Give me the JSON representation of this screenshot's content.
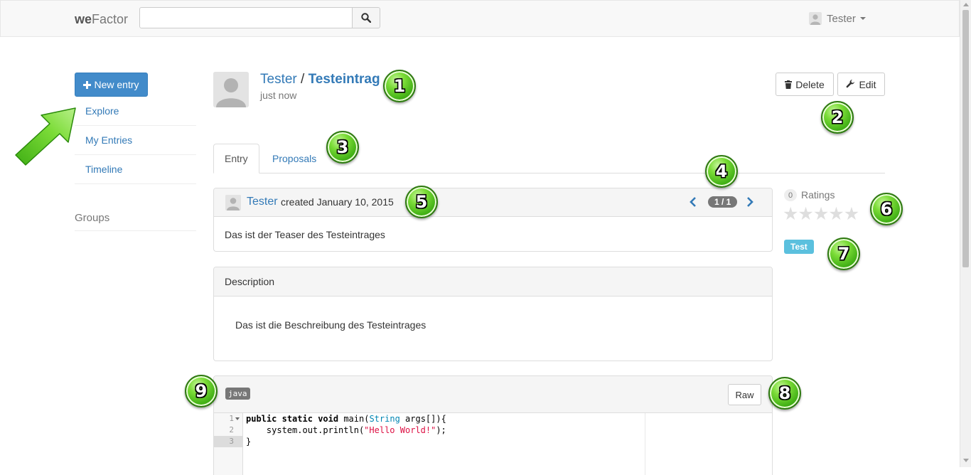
{
  "navbar": {
    "brand_prefix": "we",
    "brand_suffix": "Factor",
    "search": {
      "value": "",
      "placeholder": ""
    },
    "user_name": "Tester"
  },
  "sidebar": {
    "new_entry_label": "New entry",
    "items": [
      {
        "label": "Explore"
      },
      {
        "label": "My Entries"
      },
      {
        "label": "Timeline"
      }
    ],
    "groups_label": "Groups"
  },
  "entry": {
    "author": "Tester",
    "separator": "/",
    "title": "Testeintrag",
    "time": "just now",
    "delete_label": "Delete",
    "edit_label": "Edit"
  },
  "tabs": [
    {
      "label": "Entry",
      "active": true
    },
    {
      "label": "Proposals",
      "active": false
    }
  ],
  "version_panel": {
    "author": "Tester",
    "created_text": "created January 10, 2015",
    "page_indicator": "1 / 1",
    "teaser": "Das ist der Teaser des Testeintrages"
  },
  "description_panel": {
    "heading": "Description",
    "body": "Das ist die Beschreibung des Testeintrages"
  },
  "ratings": {
    "count": "0",
    "label": "Ratings",
    "stars_filled": 0,
    "stars_total": 5
  },
  "tag": {
    "label": "Test"
  },
  "code_panel": {
    "language": "java",
    "raw_label": "Raw",
    "lines": [
      {
        "number": "1"
      },
      {
        "number": "2"
      },
      {
        "number": "3"
      }
    ]
  },
  "callouts": [
    "1",
    "2",
    "3",
    "4",
    "5",
    "6",
    "7",
    "8",
    "9"
  ],
  "colors": {
    "primary": "#428bca",
    "link": "#337ab7",
    "tag": "#5bc0de",
    "badge": "#777777",
    "callout_green": "#4cbb17"
  }
}
